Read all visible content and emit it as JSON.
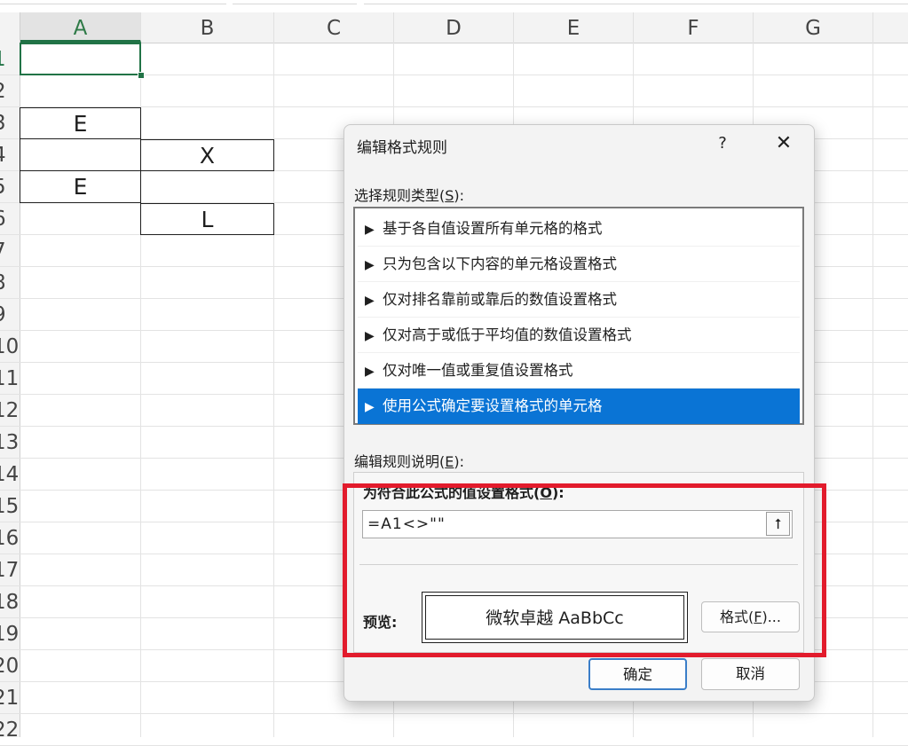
{
  "sheet": {
    "columns": [
      "A",
      "B",
      "C",
      "D",
      "E",
      "F",
      "G"
    ],
    "rows": [
      "1",
      "2",
      "3",
      "4",
      "5",
      "6",
      "7",
      "8",
      "9",
      "10",
      "11",
      "12",
      "13",
      "14",
      "15",
      "16",
      "17",
      "18",
      "19",
      "20",
      "21",
      "22"
    ],
    "cells": {
      "a3": "E",
      "b4": "X",
      "a5": "E",
      "b6": "L"
    },
    "accent_color": "#217346"
  },
  "dialog": {
    "title": "编辑格式规则",
    "help_label": "?",
    "close_label": "✕",
    "select_type_label": "选择规则类型(",
    "select_type_key": "S",
    "select_type_suffix": "):",
    "rule_types": [
      {
        "label": "基于各自值设置所有单元格的格式"
      },
      {
        "label": "只为包含以下内容的单元格设置格式"
      },
      {
        "label": "仅对排名靠前或靠后的数值设置格式"
      },
      {
        "label": "仅对高于或低于平均值的数值设置格式"
      },
      {
        "label": "仅对唯一值或重复值设置格式"
      },
      {
        "label": "使用公式确定要设置格式的单元格"
      }
    ],
    "rule_arrow": "▶",
    "selected_rule_index": 5,
    "edit_desc_label": "编辑规则说明(",
    "edit_desc_key": "E",
    "edit_desc_suffix": "):",
    "formula_heading": "为符合此公式的值设置格式(",
    "formula_heading_key": "O",
    "formula_heading_suffix": "):",
    "formula_value": "=A1<>\"\"",
    "collapse_icon": "⭡",
    "preview_label": "预览:",
    "preview_text": "微软卓越  AaBbCc",
    "format_button_prefix": "格式(",
    "format_button_key": "F",
    "format_button_suffix": ")...",
    "ok_label": "确定",
    "cancel_label": "取消",
    "selected_color": "#0a74d5",
    "highlight_color": "#e21b2c"
  }
}
